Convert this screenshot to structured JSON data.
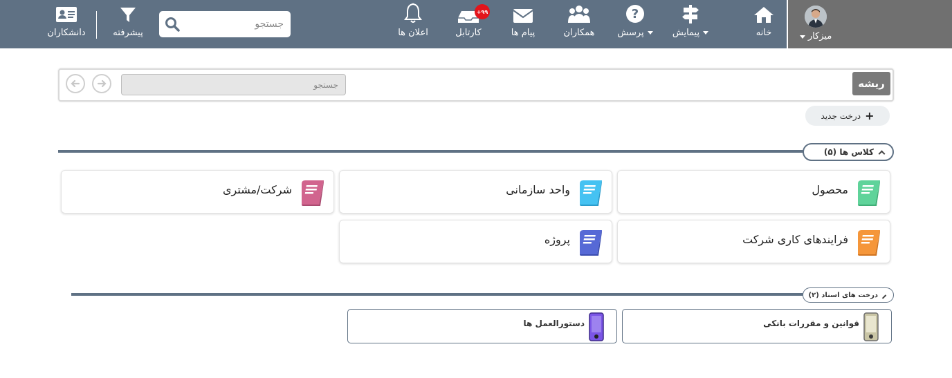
{
  "navbar": {
    "user": {
      "label": "میزکار",
      "icon": "user-avatar"
    },
    "items": {
      "home": {
        "label": "خانه",
        "icon": "home-icon"
      },
      "survey": {
        "label": "پیمایش",
        "icon": "signpost-icon"
      },
      "question": {
        "label": "پرسش",
        "icon": "question-icon"
      },
      "colleagues": {
        "label": "همکاران",
        "icon": "users-icon"
      },
      "messages": {
        "label": "پیام ها",
        "icon": "envelope-icon"
      },
      "cartable": {
        "label": "کارتابل",
        "icon": "inbox-icon",
        "badge": "۹۹+"
      },
      "notifications": {
        "label": "اعلان ها",
        "icon": "bell-icon"
      },
      "advanced": {
        "label": "پیشرفته",
        "icon": "filter-icon"
      },
      "scholars": {
        "label": "دانشکاران",
        "icon": "id-card-icon"
      }
    },
    "search": {
      "placeholder": "جستجو"
    }
  },
  "breadcrumb": {
    "root_label": "ریشه",
    "search_placeholder": "جستجو"
  },
  "new_tree_label": "درخت جدید",
  "classes_section": {
    "title": "کلاس ها (۵)",
    "items": [
      {
        "label": "محصول",
        "color": "#5fd39a"
      },
      {
        "label": "واحد سازمانی",
        "color": "#45c2f2"
      },
      {
        "label": "شرکت/مشتری",
        "color": "#d1648e"
      },
      {
        "label": "فرایندهای کاری شرکت",
        "color": "#f5963a"
      },
      {
        "label": "پروژه",
        "color": "#5669d6"
      }
    ]
  },
  "docs_section": {
    "title": "درخت های اسناد (۲)",
    "items": [
      {
        "label": "قوانین و مقررات بانکی",
        "color": "#c9c5a5"
      },
      {
        "label": "دستورالعمل ها",
        "color": "#7b55e6"
      }
    ]
  },
  "colors": {
    "navbar": "#5f7184",
    "user_area": "#707070",
    "badge": "#e3141b"
  }
}
